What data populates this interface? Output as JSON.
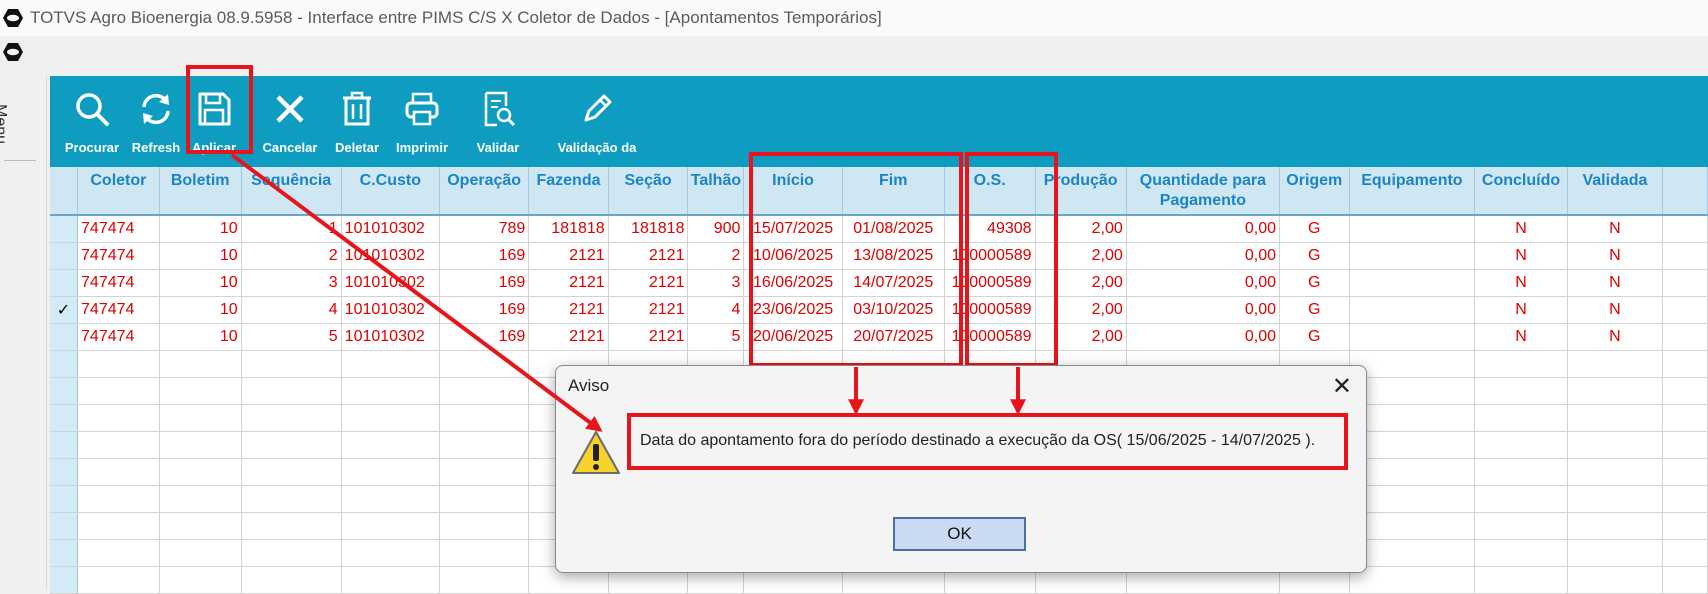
{
  "window": {
    "title": "TOTVS Agro Bioenergia 08.9.5958 - Interface entre PIMS C/S X Coletor de Dados - [Apontamentos Temporários]"
  },
  "sidebar": {
    "menu_label": "Menu"
  },
  "toolbar": {
    "buttons": [
      {
        "label": "Procurar",
        "icon": "search-icon"
      },
      {
        "label": "Refresh",
        "icon": "refresh-icon"
      },
      {
        "label": "Aplicar",
        "icon": "save-icon"
      },
      {
        "label": "Cancelar",
        "icon": "close-icon"
      },
      {
        "label": "Deletar",
        "icon": "trash-icon"
      },
      {
        "label": "Imprimir",
        "icon": "printer-icon"
      },
      {
        "label": "Validar",
        "icon": "validate-doc-icon"
      },
      {
        "label": "Validação da",
        "icon": "pencil-icon"
      }
    ]
  },
  "grid": {
    "columns": [
      "Coletor",
      "Boletim",
      "Sequência",
      "C.Custo",
      "Operação",
      "Fazenda",
      "Seção",
      "Talhão",
      "Início",
      "Fim",
      "O.S.",
      "Produção",
      "Quantidade para Pagamento",
      "Origem",
      "Equipamento",
      "Concluído",
      "Validada"
    ],
    "rows": [
      [
        "747474",
        "10",
        "1",
        "101010302",
        "789",
        "181818",
        "181818",
        "900",
        "15/07/2025",
        "01/08/2025",
        "49308",
        "2,00",
        "0,00",
        "G",
        "",
        "N",
        "N"
      ],
      [
        "747474",
        "10",
        "2",
        "101010302",
        "169",
        "2121",
        "2121",
        "2",
        "10/06/2025",
        "13/08/2025",
        "100000589",
        "2,00",
        "0,00",
        "G",
        "",
        "N",
        "N"
      ],
      [
        "747474",
        "10",
        "3",
        "101010302",
        "169",
        "2121",
        "2121",
        "3",
        "16/06/2025",
        "14/07/2025",
        "100000589",
        "2,00",
        "0,00",
        "G",
        "",
        "N",
        "N"
      ],
      [
        "747474",
        "10",
        "4",
        "101010302",
        "169",
        "2121",
        "2121",
        "4",
        "23/06/2025",
        "03/10/2025",
        "100000589",
        "2,00",
        "0,00",
        "G",
        "",
        "N",
        "N"
      ],
      [
        "747474",
        "10",
        "5",
        "101010302",
        "169",
        "2121",
        "2121",
        "5",
        "20/06/2025",
        "20/07/2025",
        "100000589",
        "2,00",
        "0,00",
        "G",
        "",
        "N",
        "N"
      ]
    ],
    "selected_row_marker": "✓",
    "selected_row": 3,
    "empty_rows": 9
  },
  "dialog": {
    "title": "Aviso",
    "close_glyph": "✕",
    "message": "Data do apontamento fora do período destinado a execução da OS( 15/06/2025 - 14/07/2025 ).",
    "ok_label": "OK",
    "icon": "warning-icon"
  },
  "colors": {
    "toolbar_bg": "#0e9dc1",
    "header_bg": "#cfe7f3",
    "row_text": "#e00000",
    "annotation": "#e8141c"
  }
}
